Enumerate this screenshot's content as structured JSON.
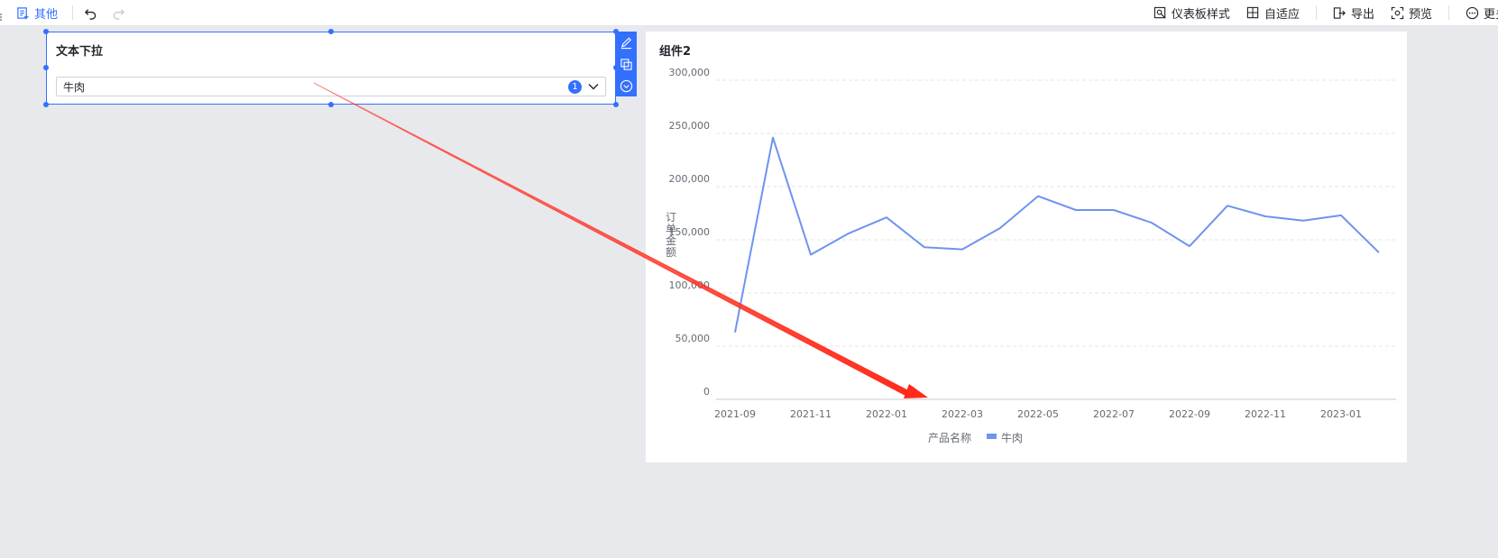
{
  "toolbar": {
    "other_label": "其他",
    "dashboard_style_label": "仪表板样式",
    "adaptive_label": "自适应",
    "export_label": "导出",
    "preview_label": "预览",
    "more_label": "更多"
  },
  "filter": {
    "title": "文本下拉",
    "selected_value": "牛肉",
    "selected_count": "1"
  },
  "chart": {
    "title": "组件2",
    "legend_title": "产品名称",
    "accent_color": "#6e93f0"
  },
  "chart_data": {
    "type": "line",
    "title": "组件2",
    "ylabel": "订单金额",
    "xlabel": "",
    "ylim": [
      0,
      300000
    ],
    "y_ticks": [
      "0",
      "50,000",
      "100,000",
      "150,000",
      "200,000",
      "250,000",
      "300,000"
    ],
    "x_tick_labels": [
      "2021-09",
      "2021-11",
      "2022-01",
      "2022-03",
      "2022-05",
      "2022-07",
      "2022-09",
      "2022-11",
      "2023-01"
    ],
    "x": [
      "2021-09",
      "2021-10",
      "2021-11",
      "2021-12",
      "2022-01",
      "2022-02",
      "2022-03",
      "2022-04",
      "2022-05",
      "2022-06",
      "2022-07",
      "2022-08",
      "2022-09",
      "2022-10",
      "2022-11",
      "2022-12",
      "2023-01",
      "2023-02"
    ],
    "series": [
      {
        "name": "牛肉",
        "color": "#6e93f0",
        "values": [
          63000,
          246000,
          136000,
          156000,
          171000,
          143000,
          141000,
          161000,
          191000,
          178000,
          178000,
          166000,
          144000,
          182000,
          172000,
          168000,
          173000,
          138000
        ]
      }
    ],
    "legend_position": "bottom",
    "grid": true
  }
}
